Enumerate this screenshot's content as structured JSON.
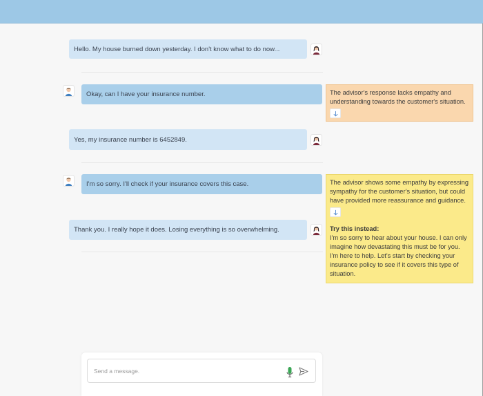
{
  "chat": {
    "messages": [
      {
        "role": "customer",
        "text": "Hello. My house burned down yesterday. I don't know what to do now..."
      },
      {
        "role": "advisor",
        "text": "Okay, can I have your insurance number."
      },
      {
        "role": "customer",
        "text": "Yes, my insurance number is 6452849."
      },
      {
        "role": "advisor",
        "text": "I'm so sorry. I'll check if your insurance covers this case."
      },
      {
        "role": "customer",
        "text": "Thank you. I really hope it does. Losing everything is so overwhelming."
      }
    ]
  },
  "feedback": [
    {
      "color": "#fad7ae",
      "text": "The advisor's response lacks empathy and understanding towards the customer's situation."
    },
    {
      "color": "#fbea8a",
      "text": "The advisor shows some empathy by expressing sympathy for the customer's situation, but could have provided more reassurance and guidance.",
      "try_title": "Try this instead:",
      "try_text": "I'm so sorry to hear about your house. I can only imagine how devastating this must be for you. I'm here to help. Let's start by checking your insurance policy to see if it covers this type of situation."
    }
  ],
  "composer": {
    "placeholder": "Send a message."
  },
  "colors": {
    "header": "#9dc8e6",
    "customer_bubble": "#d2e5f5",
    "advisor_bubble": "#a9cfea",
    "feedback_warning": "#fad7ae",
    "feedback_suggestion": "#fbea8a",
    "mic_accent": "#3aa655"
  },
  "icons": {
    "customer_avatar": "woman-avatar-icon",
    "advisor_avatar": "man-avatar-icon",
    "expand": "arrow-down-icon",
    "mic": "microphone-icon",
    "send": "send-icon"
  }
}
